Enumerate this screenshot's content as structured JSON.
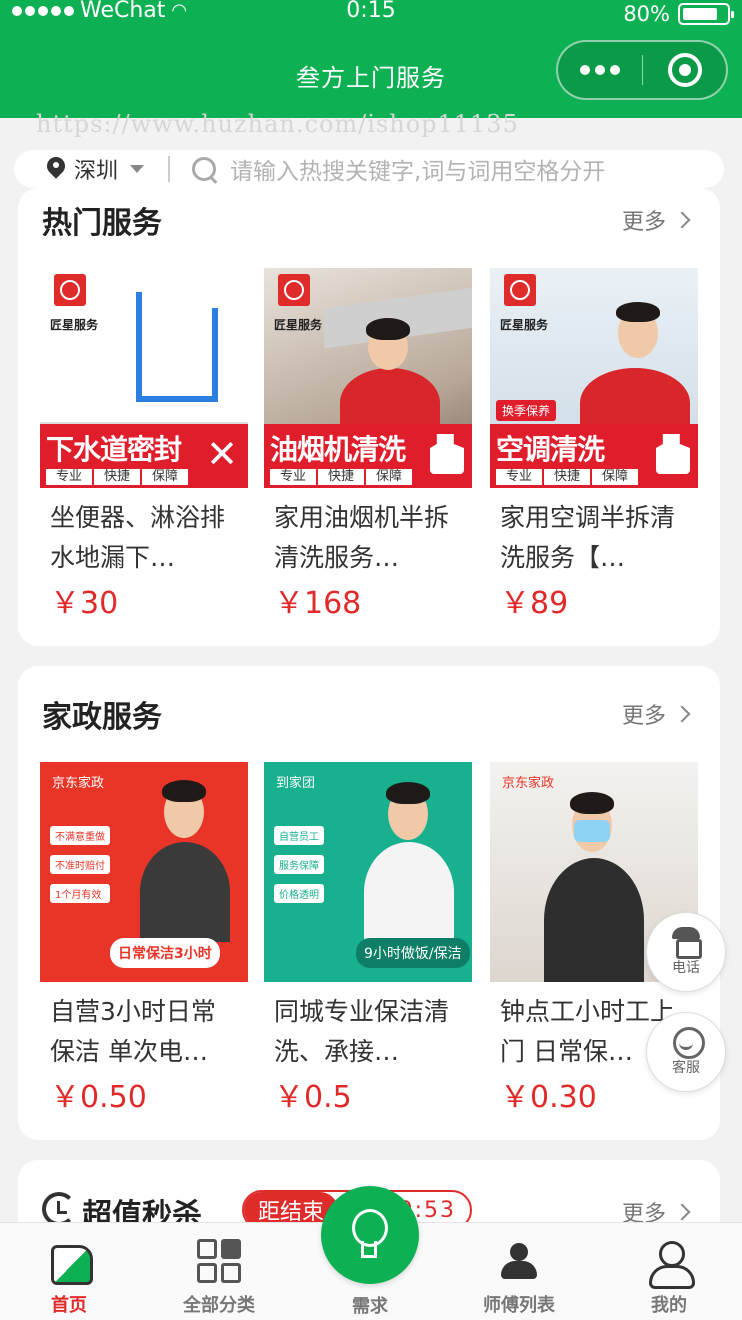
{
  "status_bar": {
    "carrier": "WeChat",
    "time": "0:15",
    "battery": "80%"
  },
  "nav": {
    "title": "叁方上门服务"
  },
  "watermark": "https://www.huzhan.com/ishop11135",
  "search": {
    "city": "深圳",
    "placeholder": "请输入热搜关键字,词与词用空格分开"
  },
  "hot_services": {
    "title": "热门服务",
    "more": "更多",
    "items": [
      {
        "name": "坐便器、淋浴排水地漏下…",
        "price": "￥30",
        "banner": "下水道密封",
        "brand": "匠星服务",
        "tags": [
          "专业",
          "快捷",
          "保障"
        ]
      },
      {
        "name": "家用油烟机半拆清洗服务…",
        "price": "￥168",
        "banner": "油烟机清洗",
        "brand": "匠星服务",
        "tags": [
          "专业",
          "快捷",
          "保障"
        ]
      },
      {
        "name": "家用空调半拆清洗服务【…",
        "price": "￥89",
        "banner": "空调清洗",
        "brand": "匠星服务",
        "tags": [
          "专业",
          "快捷",
          "保障"
        ],
        "badge": "换季保养"
      }
    ]
  },
  "housekeeping": {
    "title": "家政服务",
    "more": "更多",
    "items": [
      {
        "name": "自营3小时日常保洁 单次电…",
        "price": "￥0.50",
        "logo": "京东家政",
        "band": "日常保洁3小时",
        "checks": [
          "不满意重做",
          "不准时赔付",
          "1个月有效"
        ]
      },
      {
        "name": "同城专业保洁清洗、承接…",
        "price": "￥0.5",
        "logo": "到家团",
        "band": "9小时做饭/保洁",
        "checks": [
          "自营员工",
          "服务保障",
          "价格透明"
        ]
      },
      {
        "name": "钟点工小时工上门 日常保…",
        "price": "￥0.30",
        "logo": "京东家政"
      }
    ]
  },
  "float": {
    "phone": "电话",
    "service": "客服"
  },
  "flash_sale": {
    "title": "超值秒杀",
    "countdown_label": "距结束",
    "countdown_time": "9:53",
    "more": "更多"
  },
  "tabbar": {
    "home": "首页",
    "categories": "全部分类",
    "demand": "需求",
    "masters": "师傅列表",
    "mine": "我的"
  },
  "colors": {
    "brand_green": "#0db153",
    "price_red": "#e02b2b"
  }
}
